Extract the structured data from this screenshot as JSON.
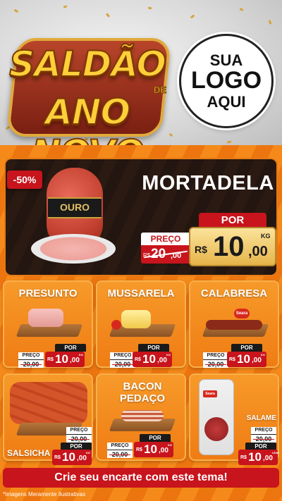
{
  "header": {
    "title_line1": "SALDÃO",
    "title_de": "DE",
    "title_line2": "ANO NOVO",
    "logo_line1": "SUA",
    "logo_line2": "LOGO",
    "logo_line3": "AQUI"
  },
  "featured": {
    "discount": "-50%",
    "brand_label": "OURO",
    "name": "MORTADELA",
    "por_label": "POR",
    "preco_label": "PREÇO",
    "old_currency": "R$",
    "old_int": "20",
    "old_dec": ",00",
    "currency": "R$",
    "price_int": "10",
    "price_dec": ",00",
    "unit": "KG"
  },
  "products": [
    {
      "name": "PRESUNTO",
      "preco_label": "PREÇO",
      "old": "20,00",
      "por_label": "POR",
      "currency": "R$",
      "price_int": "10",
      "price_dec": ",00",
      "unit": "KG"
    },
    {
      "name": "MUSSARELA",
      "preco_label": "PREÇO",
      "old": "20,00",
      "por_label": "POR",
      "currency": "R$",
      "price_int": "10",
      "price_dec": ",00",
      "unit": "KG"
    },
    {
      "name": "CALABRESA",
      "preco_label": "PREÇO",
      "old": "20,00",
      "por_label": "POR",
      "currency": "R$",
      "price_int": "10",
      "price_dec": ",00",
      "unit": "KG",
      "brand": "Seara"
    },
    {
      "name": "SALSICHA",
      "preco_label": "PREÇO",
      "old": "20,00",
      "por_label": "POR",
      "currency": "R$",
      "price_int": "10",
      "price_dec": ",00",
      "unit": "KG"
    },
    {
      "name": "BACON PEDAÇO",
      "preco_label": "PREÇO",
      "old": "20,00",
      "por_label": "POR",
      "currency": "R$",
      "price_int": "10",
      "price_dec": ",00",
      "unit": "KG"
    },
    {
      "name": "SALAME",
      "preco_label": "PREÇO",
      "old": "20,00",
      "por_label": "POR",
      "currency": "R$",
      "price_int": "10",
      "price_dec": ",00",
      "unit": "UNID",
      "brand": "Seara"
    }
  ],
  "cta": "Crie seu encarte com este tema!",
  "disclaimer": "*Imagens Meramente Ilustrativas",
  "colors": {
    "orange": "#f07a12",
    "red": "#c8141c",
    "gold": "#e6b54a",
    "dark": "#231510"
  }
}
